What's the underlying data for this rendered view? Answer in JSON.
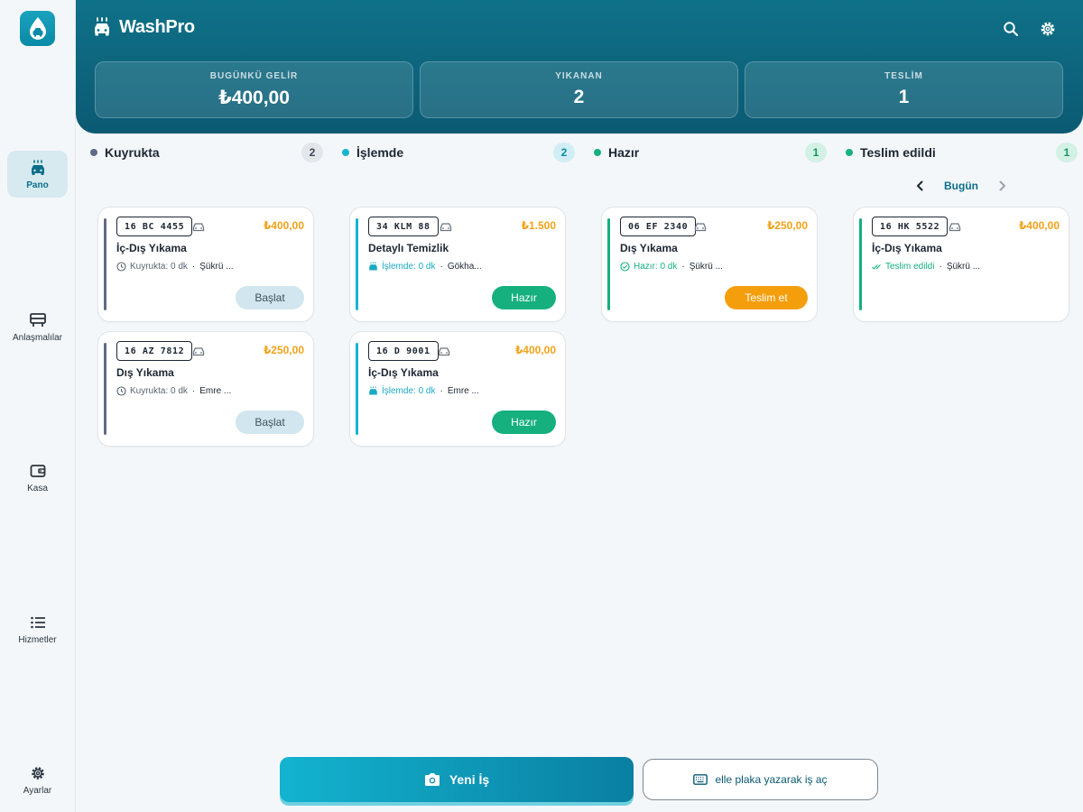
{
  "app": {
    "name": "WashPro"
  },
  "sidebar": {
    "items": [
      {
        "label": "Pano",
        "icon": "car-wash-icon",
        "active": true
      },
      {
        "label": "Anlaşmalılar",
        "icon": "contract-icon",
        "active": false
      },
      {
        "label": "Kasa",
        "icon": "wallet-icon",
        "active": false
      },
      {
        "label": "Hizmetler",
        "icon": "list-icon",
        "active": false
      },
      {
        "label": "Ayarlar",
        "icon": "gear-icon",
        "active": false
      }
    ]
  },
  "stats": [
    {
      "label": "BUGÜNKÜ GELİR",
      "value": "₺400,00"
    },
    {
      "label": "YIKANAN",
      "value": "2"
    },
    {
      "label": "TESLİM",
      "value": "1"
    }
  ],
  "columns": [
    {
      "title": "Kuyrukta",
      "count": "2",
      "color": "#5f6b86"
    },
    {
      "title": "İşlemde",
      "count": "2",
      "color": "#18b4cf"
    },
    {
      "title": "Hazır",
      "count": "1",
      "color": "#16b07f"
    },
    {
      "title": "Teslim edildi",
      "count": "1",
      "color": "#16b07f"
    }
  ],
  "date_nav": {
    "label": "Bugün"
  },
  "cards": {
    "queued": [
      {
        "plate": "16 BC 4455",
        "price": "₺400,00",
        "service": "İç-Dış Yıkama",
        "status": "Kuyrukta: 0 dk",
        "person": "Şükrü ...",
        "action": "Başlat"
      },
      {
        "plate": "16 AZ 7812",
        "price": "₺250,00",
        "service": "Dış Yıkama",
        "status": "Kuyrukta: 0 dk",
        "person": "Emre ...",
        "action": "Başlat"
      }
    ],
    "in_progress": [
      {
        "plate": "34 KLM 88",
        "price": "₺1.500",
        "service": "Detaylı Temizlik",
        "status": "İşlemde: 0 dk",
        "person": "Gökha...",
        "action": "Hazır"
      },
      {
        "plate": "16 D 9001",
        "price": "₺400,00",
        "service": "İç-Dış Yıkama",
        "status": "İşlemde: 0 dk",
        "person": "Emre ...",
        "action": "Hazır"
      }
    ],
    "ready": [
      {
        "plate": "06 EF 2340",
        "price": "₺250,00",
        "service": "Dış Yıkama",
        "status": "Hazır: 0 dk",
        "person": "Şükrü ...",
        "action": "Teslim et"
      }
    ],
    "delivered": [
      {
        "plate": "16 HK 5522",
        "price": "₺400,00",
        "service": "İç-Dış Yıkama",
        "status": "Teslim edildi",
        "person": "Şükrü ..."
      }
    ]
  },
  "bottom": {
    "primary_label": "Yeni İş",
    "secondary_label": "elle plaka yazarak iş aç"
  },
  "colors": {
    "accent": "#0b6e88",
    "price": "#f0a21a",
    "ready_green": "#16b07f",
    "delivered_orange": "#f59e0b"
  }
}
